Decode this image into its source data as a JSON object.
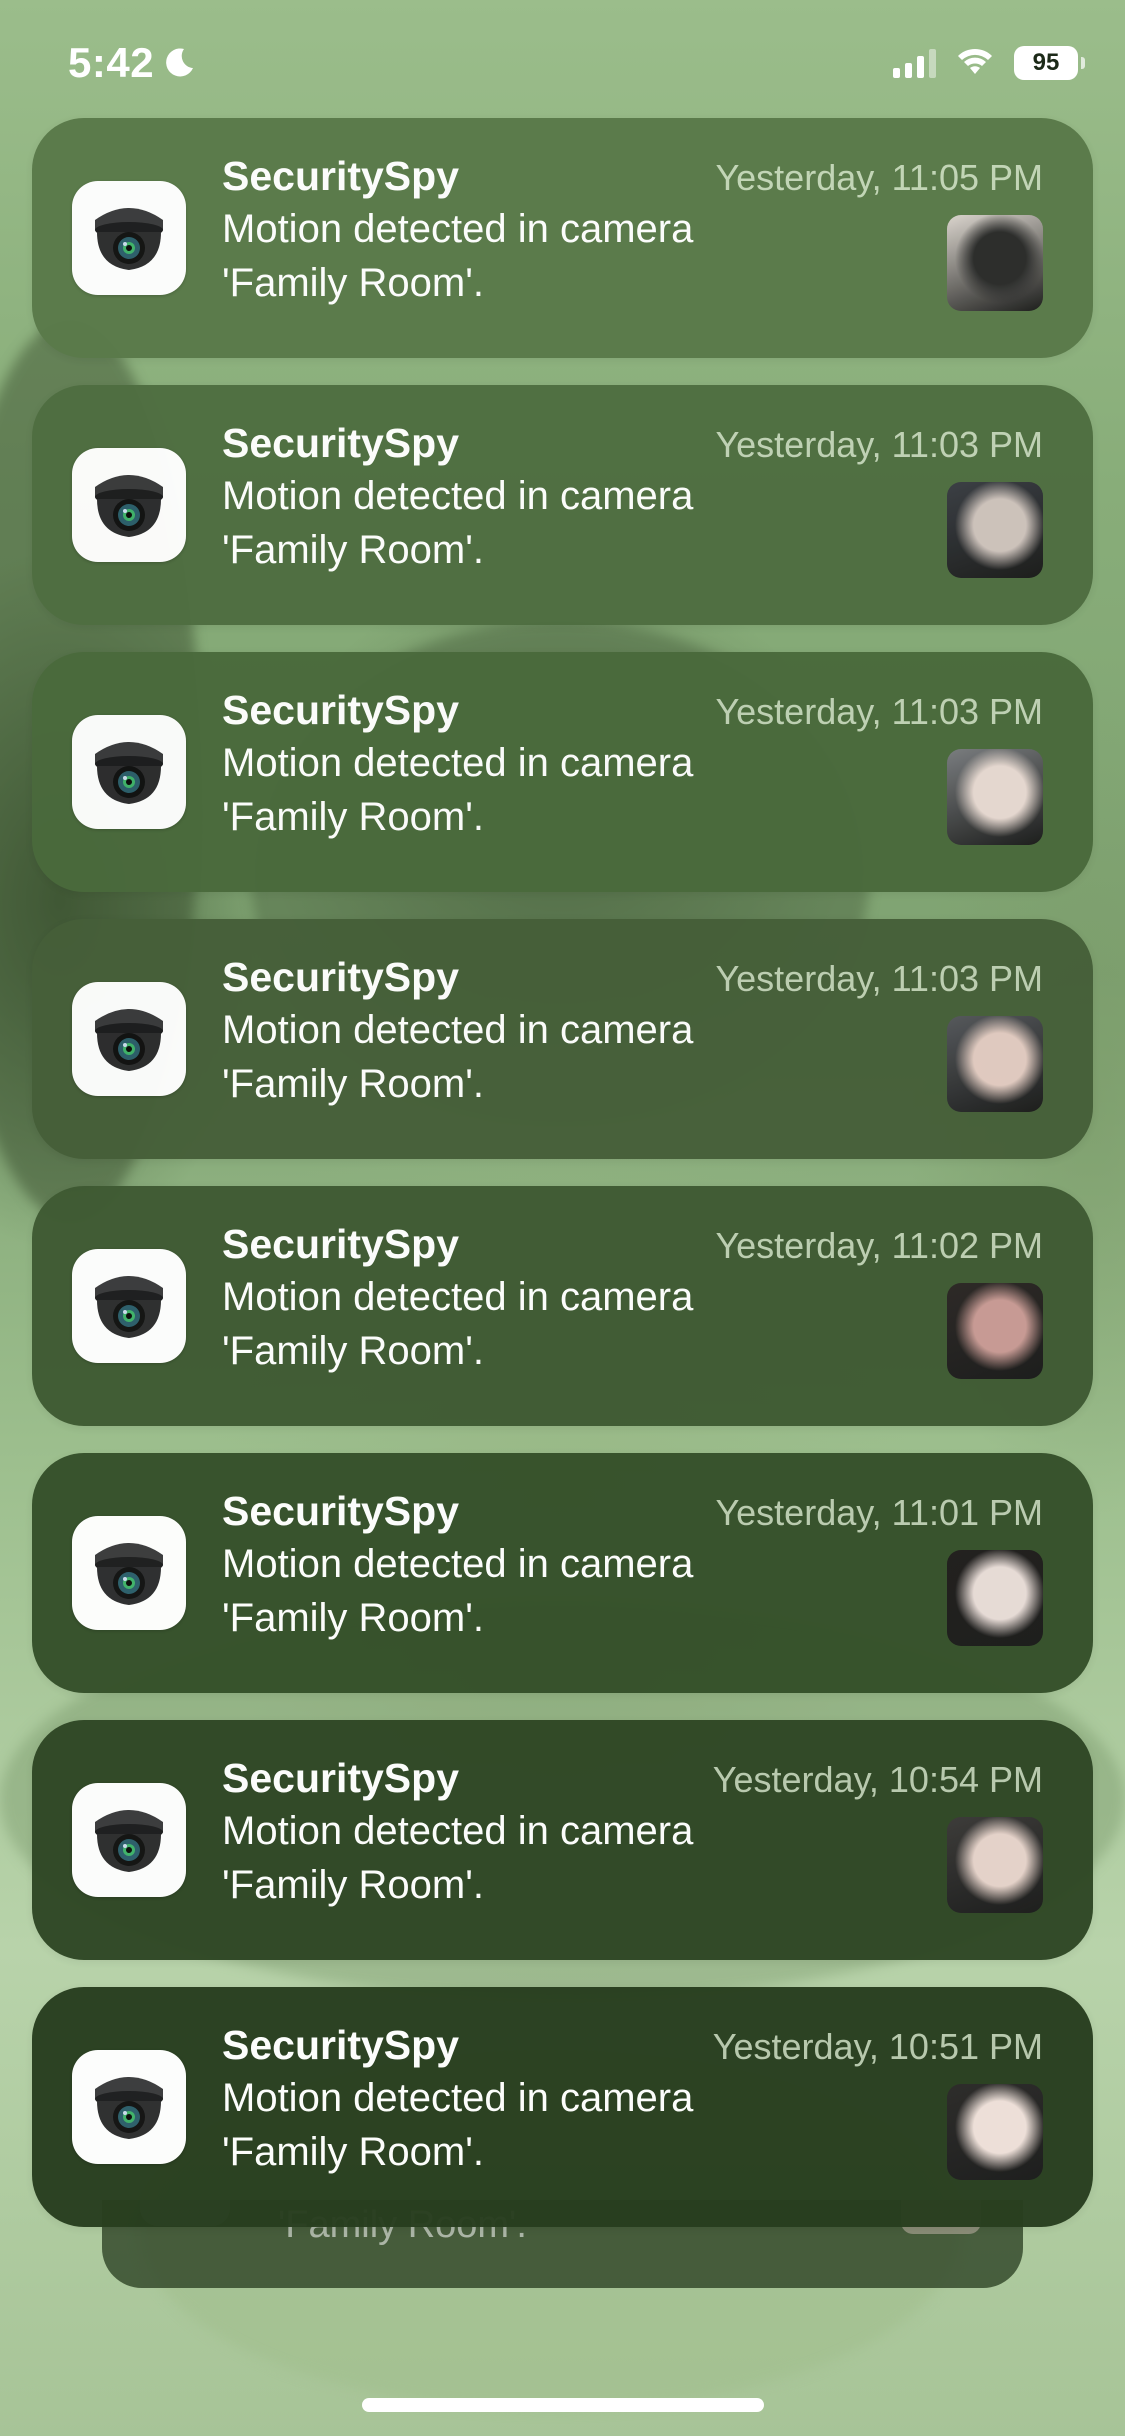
{
  "status_bar": {
    "time": "5:42",
    "battery": "95",
    "icons": [
      "moon-icon",
      "cellular-signal-icon",
      "wifi-icon",
      "battery-icon"
    ]
  },
  "notifications": [
    {
      "app": "SecuritySpy",
      "time": "Yesterday, 11:05 PM",
      "line1": "Motion detected in camera",
      "line2": "'Family Room'.",
      "tint": "#5a7a4a"
    },
    {
      "app": "SecuritySpy",
      "time": "Yesterday, 11:03 PM",
      "line1": "Motion detected in camera",
      "line2": "'Family Room'.",
      "tint": "#4f6e41"
    },
    {
      "app": "SecuritySpy",
      "time": "Yesterday, 11:03 PM",
      "line1": "Motion detected in camera",
      "line2": "'Family Room'.",
      "tint": "#4a6a3c"
    },
    {
      "app": "SecuritySpy",
      "time": "Yesterday, 11:03 PM",
      "line1": "Motion detected in camera",
      "line2": "'Family Room'.",
      "tint": "#465f39"
    },
    {
      "app": "SecuritySpy",
      "time": "Yesterday, 11:02 PM",
      "line1": "Motion detected in camera",
      "line2": "'Family Room'.",
      "tint": "#3f5a33"
    },
    {
      "app": "SecuritySpy",
      "time": "Yesterday, 11:01 PM",
      "line1": "Motion detected in camera",
      "line2": "'Family Room'.",
      "tint": "#35502a"
    },
    {
      "app": "SecuritySpy",
      "time": "Yesterday, 10:54 PM",
      "line1": "Motion detected in camera",
      "line2": "'Family Room'.",
      "tint": "#2f4725"
    },
    {
      "app": "SecuritySpy",
      "time": "Yesterday, 10:51 PM",
      "line1": "Motion detected in camera",
      "line2": "'Family Room'.",
      "tint": "#283e1f"
    }
  ],
  "stack_peek": {
    "text": "'Family Room'."
  }
}
